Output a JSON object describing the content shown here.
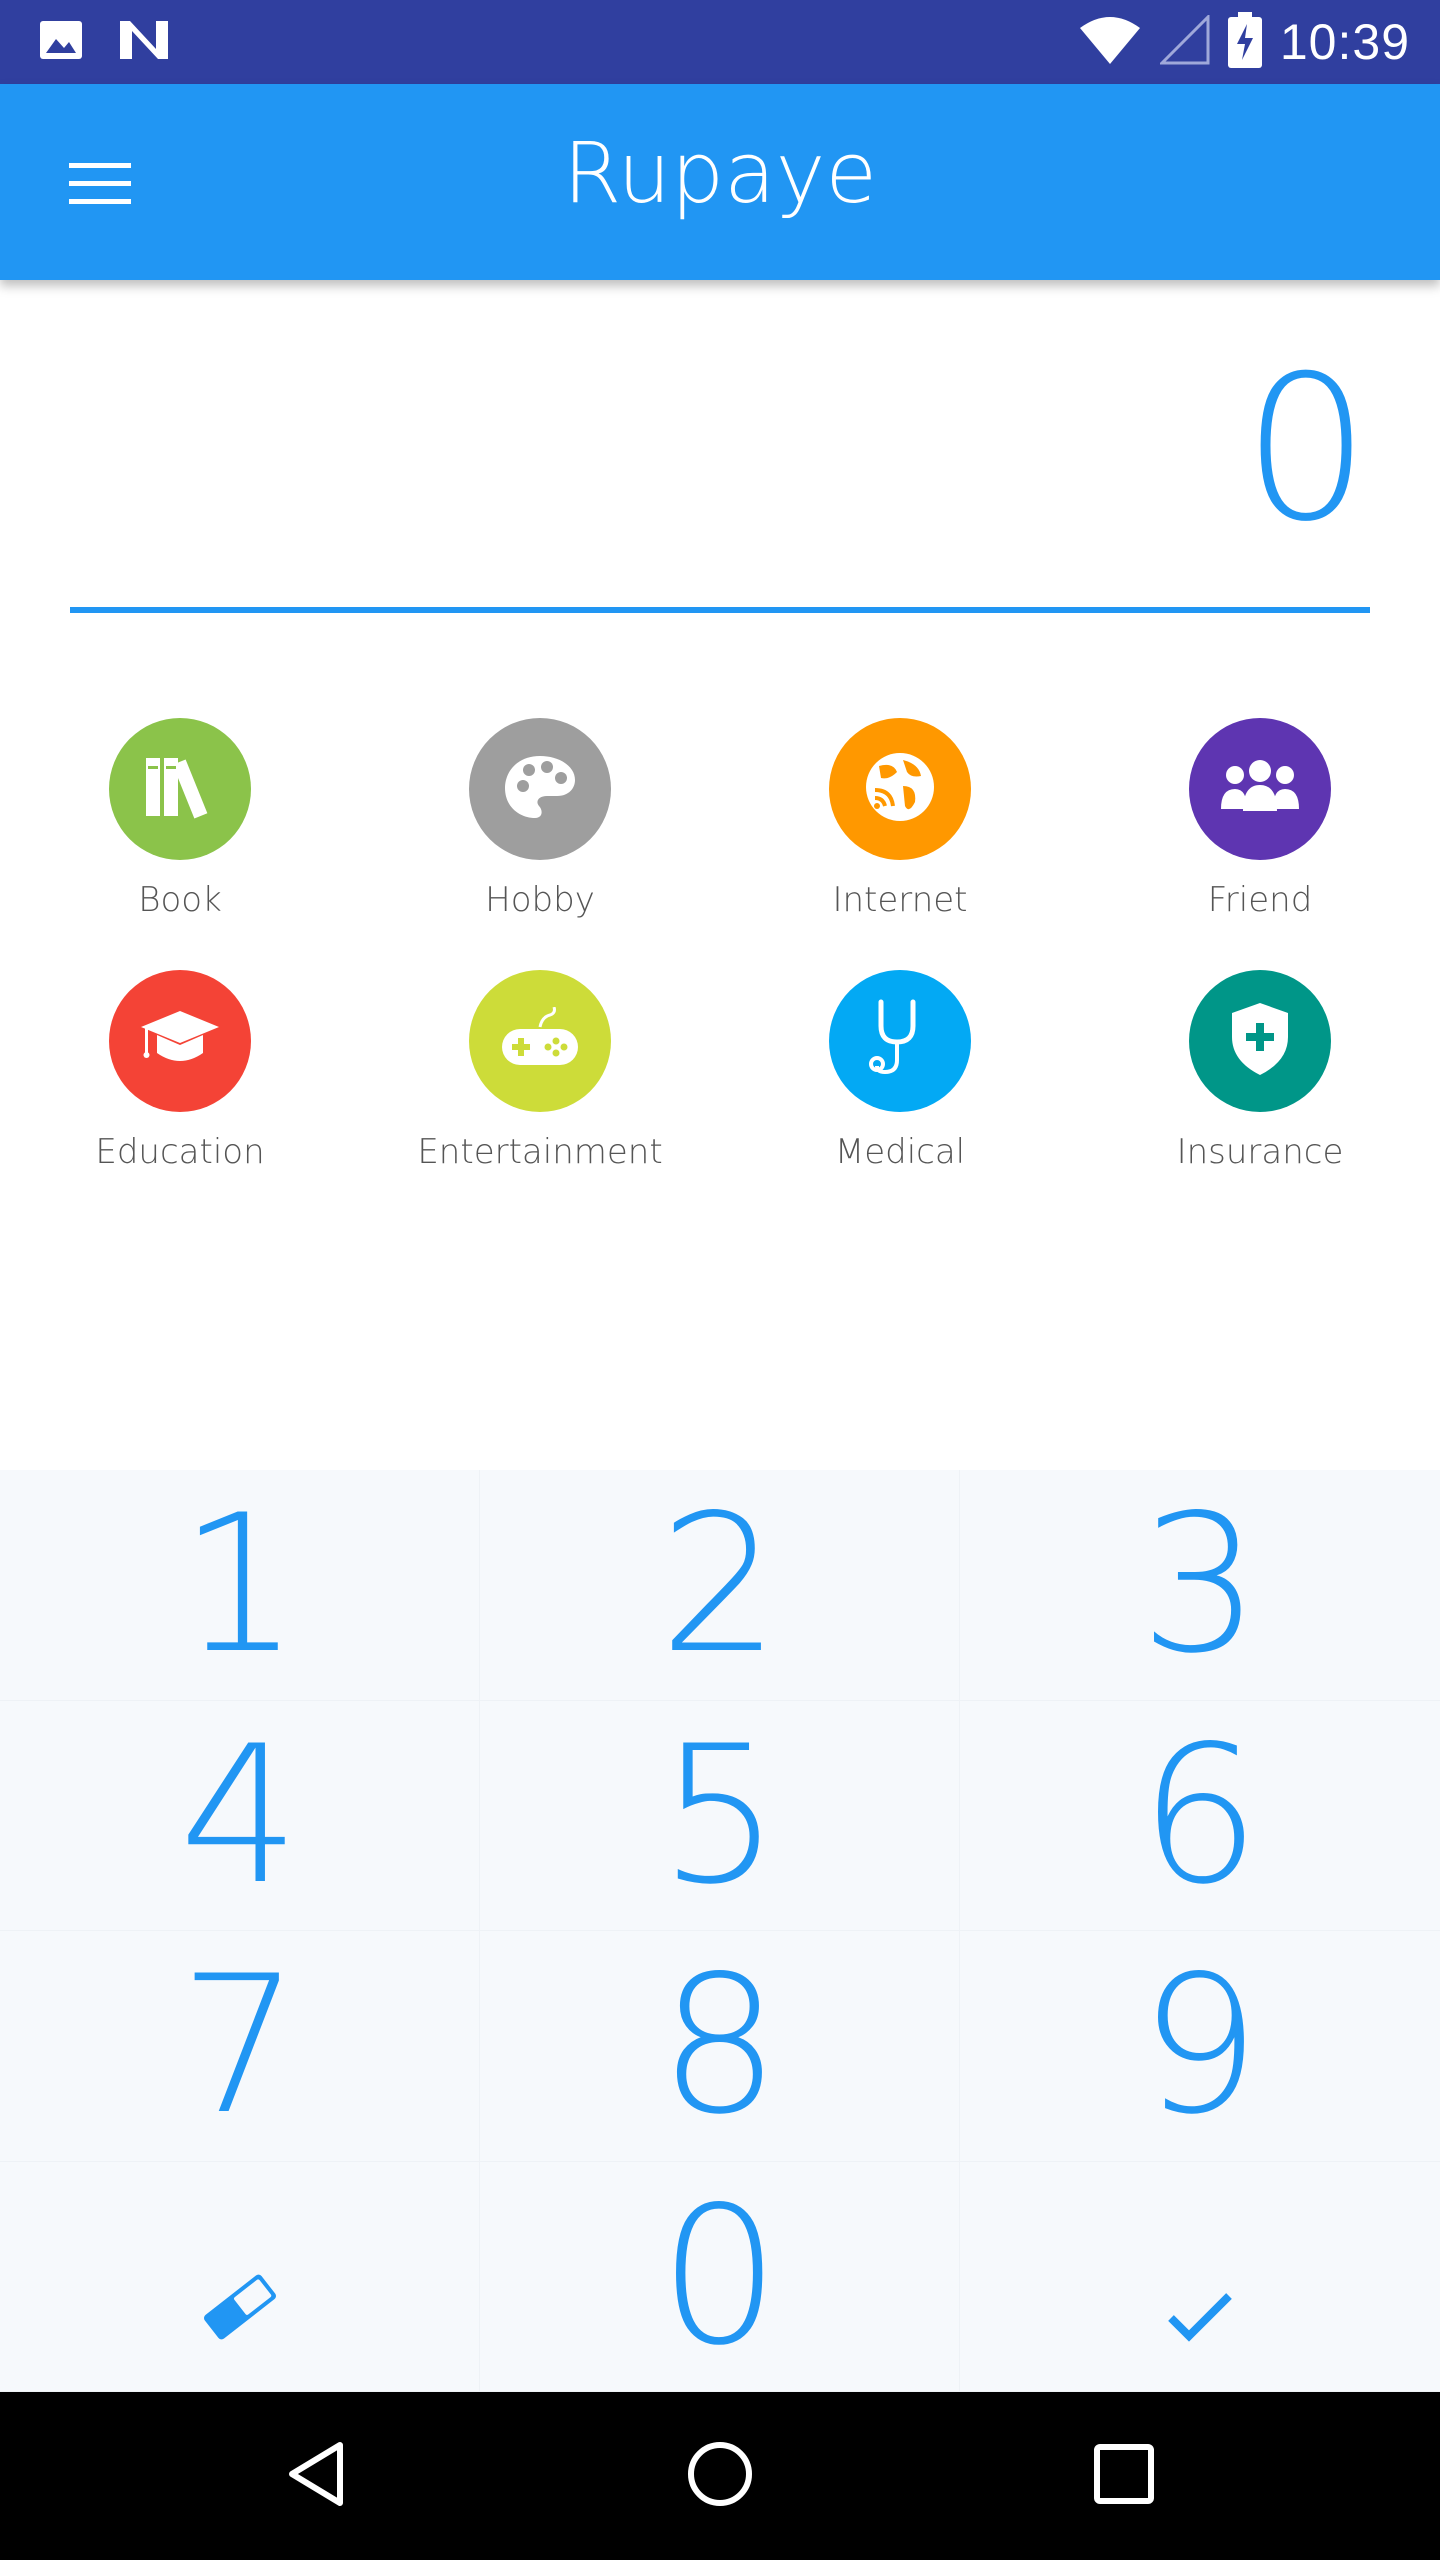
{
  "status_bar": {
    "time": "10:39",
    "left_icons": [
      "image-icon",
      "n-logo-icon"
    ],
    "right_icons": [
      "wifi-icon",
      "signal-icon",
      "battery-charging-icon"
    ]
  },
  "app_bar": {
    "title": "Rupaye",
    "menu_icon": "menu-icon"
  },
  "amount": {
    "value": "0"
  },
  "categories": [
    {
      "label": "Book",
      "color": "#8BC34A",
      "icon": "book-icon"
    },
    {
      "label": "Hobby",
      "color": "#9E9E9E",
      "icon": "palette-icon"
    },
    {
      "label": "Internet",
      "color": "#FF9800",
      "icon": "globe-icon"
    },
    {
      "label": "Friend",
      "color": "#5E35B1",
      "icon": "people-icon"
    },
    {
      "label": "Education",
      "color": "#F44336",
      "icon": "graduation-cap-icon"
    },
    {
      "label": "Entertainment",
      "color": "#CDDC39",
      "icon": "gamepad-icon"
    },
    {
      "label": "Medical",
      "color": "#03A9F4",
      "icon": "stethoscope-icon"
    },
    {
      "label": "Insurance",
      "color": "#009688",
      "icon": "shield-icon"
    }
  ],
  "keypad": {
    "keys": [
      "1",
      "2",
      "3",
      "4",
      "5",
      "6",
      "7",
      "8",
      "9",
      "",
      "0",
      ""
    ],
    "clear_icon": "eraser-icon",
    "confirm_icon": "check-icon"
  },
  "nav_bar": {
    "icons": [
      "back-icon",
      "home-icon",
      "recents-icon"
    ]
  },
  "colors": {
    "status_bar": "#303F9F",
    "primary": "#2196F3",
    "keypad_bg": "#F6F9FC"
  }
}
